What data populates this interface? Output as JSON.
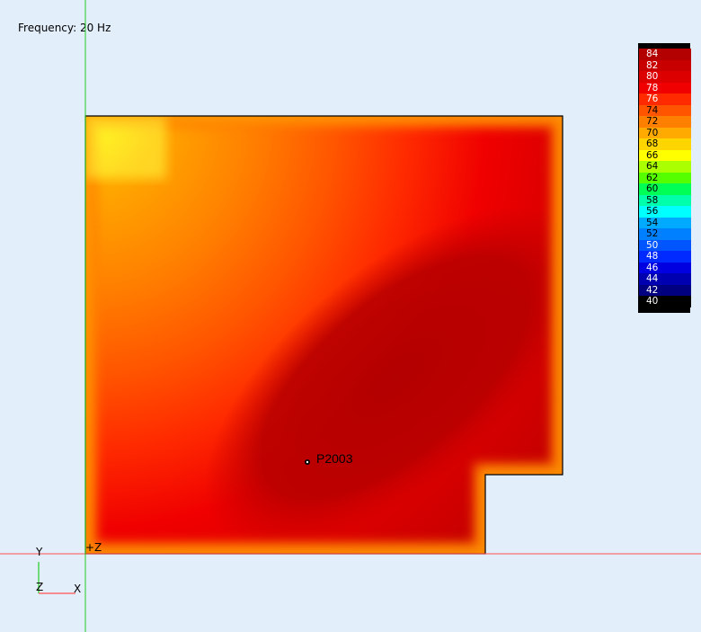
{
  "frequency_label": "Frequency: 20 Hz",
  "probe_label": "P2003",
  "origin_label": "+Z",
  "axes": {
    "y": "Y",
    "z": "Z",
    "x": "X"
  },
  "colors": {
    "background": "#e3eefb",
    "axis_x_line": "#ff5050",
    "axis_y_line": "#22cc22",
    "outline": "#000000"
  },
  "legend": {
    "levels": [
      {
        "label": "84",
        "color": "#b30000"
      },
      {
        "label": "82",
        "color": "#c80000"
      },
      {
        "label": "80",
        "color": "#dc0000"
      },
      {
        "label": "78",
        "color": "#f00000"
      },
      {
        "label": "76",
        "color": "#ff2a00"
      },
      {
        "label": "74",
        "color": "#ff5500"
      },
      {
        "label": "72",
        "color": "#ff8000"
      },
      {
        "label": "70",
        "color": "#ffaa00"
      },
      {
        "label": "68",
        "color": "#ffd500"
      },
      {
        "label": "66",
        "color": "#ffff00"
      },
      {
        "label": "64",
        "color": "#aaff00"
      },
      {
        "label": "62",
        "color": "#55ff00"
      },
      {
        "label": "60",
        "color": "#00ff55"
      },
      {
        "label": "58",
        "color": "#00ffaa"
      },
      {
        "label": "56",
        "color": "#00ffff"
      },
      {
        "label": "54",
        "color": "#00aaff"
      },
      {
        "label": "52",
        "color": "#0080ff"
      },
      {
        "label": "50",
        "color": "#0055ff"
      },
      {
        "label": "48",
        "color": "#002aff"
      },
      {
        "label": "46",
        "color": "#0000e0"
      },
      {
        "label": "44",
        "color": "#0000b0"
      },
      {
        "label": "42",
        "color": "#000080"
      },
      {
        "label": "40",
        "color": "#000000"
      }
    ]
  }
}
